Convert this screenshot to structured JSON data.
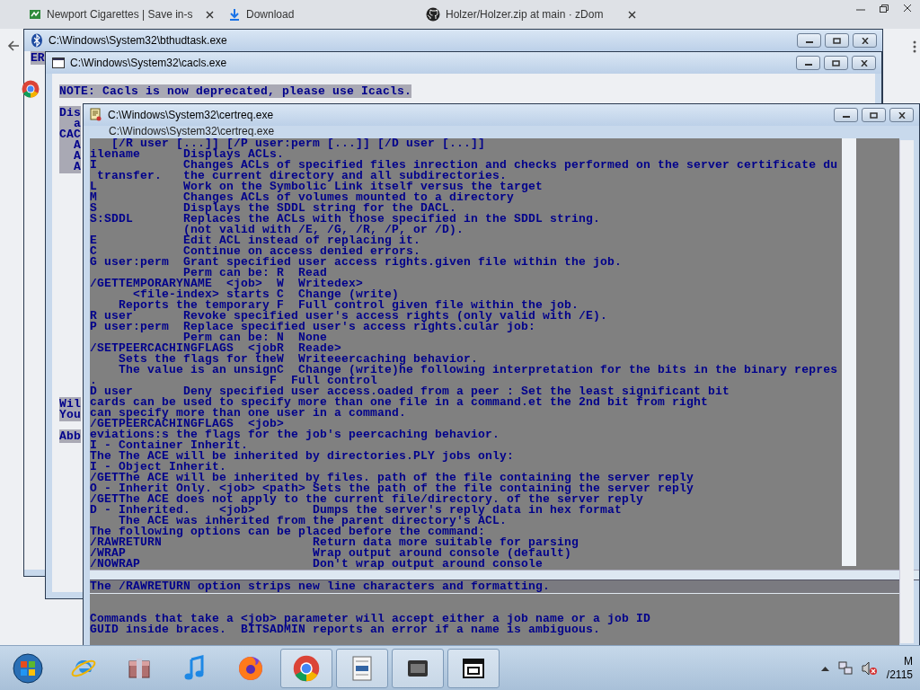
{
  "browser": {
    "tabs": [
      {
        "title": "Newport Cigarettes | Save in-s",
        "closable": true
      },
      {
        "title": "Download",
        "closable": false
      },
      {
        "title": "Holzer/Holzer.zip at main · zDom",
        "closable": true
      }
    ]
  },
  "windows": [
    {
      "title": "C:\\Windows\\System32\\bthudtask.exe",
      "groups": [
        [
          "ER"
        ]
      ]
    },
    {
      "title": "C:\\Windows\\System32\\cacls.exe",
      "groups": [
        [
          "NOTE: Cacls is now deprecated, please use Icacls."
        ],
        [
          "Dis",
          "  a",
          "CAC",
          "  A",
          "  A",
          "  A"
        ],
        [
          "Wil",
          "You"
        ],
        [
          "Abb"
        ]
      ]
    }
  ],
  "certreq": {
    "title": "C:\\Windows\\System32\\certreq.exe",
    "ghost_title": "C:\\Windows\\System32\\certreq.exe",
    "lines": [
      "   [/R user [...]] [/P user:perm [...]] [/D user [...]]",
      "ilename      Displays ACLs.",
      "I            Changes ACLs of specified files inrection and checks performed on the server certificate du",
      " transfer.   the current directory and all subdirectories.",
      "L            Work on the Symbolic Link itself versus the target",
      "M            Changes ACLs of volumes mounted to a directory",
      "S            Displays the SDDL string for the DACL.",
      "S:SDDL       Replaces the ACLs with those specified in the SDDL string.",
      "             (not valid with /E, /G, /R, /P, or /D).",
      "E            Edit ACL instead of replacing it.",
      "C            Continue on access denied errors.",
      "G user:perm  Grant specified user access rights.given file within the job.",
      "             Perm can be: R  Read",
      "/GETTEMPORARYNAME  <job>  W  Writedex>",
      "      <file-index> starts C  Change (write)",
      "    Reports the temporary F  Full control given file within the job.",
      "R user       Revoke specified user's access rights (only valid with /E).",
      "P user:perm  Replace specified user's access rights.cular job:",
      "             Perm can be: N  None",
      "/SETPEERCACHINGFLAGS  <jobR  Reade>",
      "    Sets the flags for theW  Writeeercaching behavior.",
      "    The value is an unsignC  Change (write)he following interpretation for the bits in the binary repres",
      ".                        F  Full control",
      "D user       Deny specified user access.oaded from a peer : Set the least significant bit",
      "cards can be used to specify more than one file in a command.et the 2nd bit from right",
      "can specify more than one user in a command.",
      "/GETPEERCACHINGFLAGS  <job>",
      "eviations:s the flags for the job's peercaching behavior.",
      "I - Container Inherit.",
      "The The ACE will be inherited by directories.PLY jobs only:",
      "I - Object Inherit.",
      "/GETThe ACE will be inherited by files. path of the file containing the server reply",
      "O - Inherit Only. <job> <path> Sets the path of the file containing the server reply",
      "/GETThe ACE does not apply to the current file/directory. of the server reply",
      "D - Inherited.    <job>        Dumps the server's reply data in hex format",
      "    The ACE was inherited from the parent directory's ACL.",
      "The following options can be placed before the command:",
      "/RAWRETURN                     Return data more suitable for parsing",
      "/WRAP                          Wrap output around console (default)",
      "/NOWRAP                        Don't wrap output around console"
    ],
    "note": "The /RAWRETURN option strips new line characters and formatting.",
    "lower_lines": [
      "Commands that take a <job> parameter will accept either a job name or a job ID",
      "GUID inside braces.  BITSADMIN reports an error if a name is ambiguous."
    ]
  },
  "taskbar": {
    "items": [
      {
        "kind": "ie",
        "active": false
      },
      {
        "kind": "archive",
        "active": false
      },
      {
        "kind": "music",
        "active": false
      },
      {
        "kind": "firefox",
        "active": false
      },
      {
        "kind": "chrome",
        "active": true
      },
      {
        "kind": "document",
        "active": true
      },
      {
        "kind": "app",
        "active": true
      },
      {
        "kind": "window",
        "active": true
      }
    ],
    "clock": [
      "M",
      "/2115"
    ]
  }
}
